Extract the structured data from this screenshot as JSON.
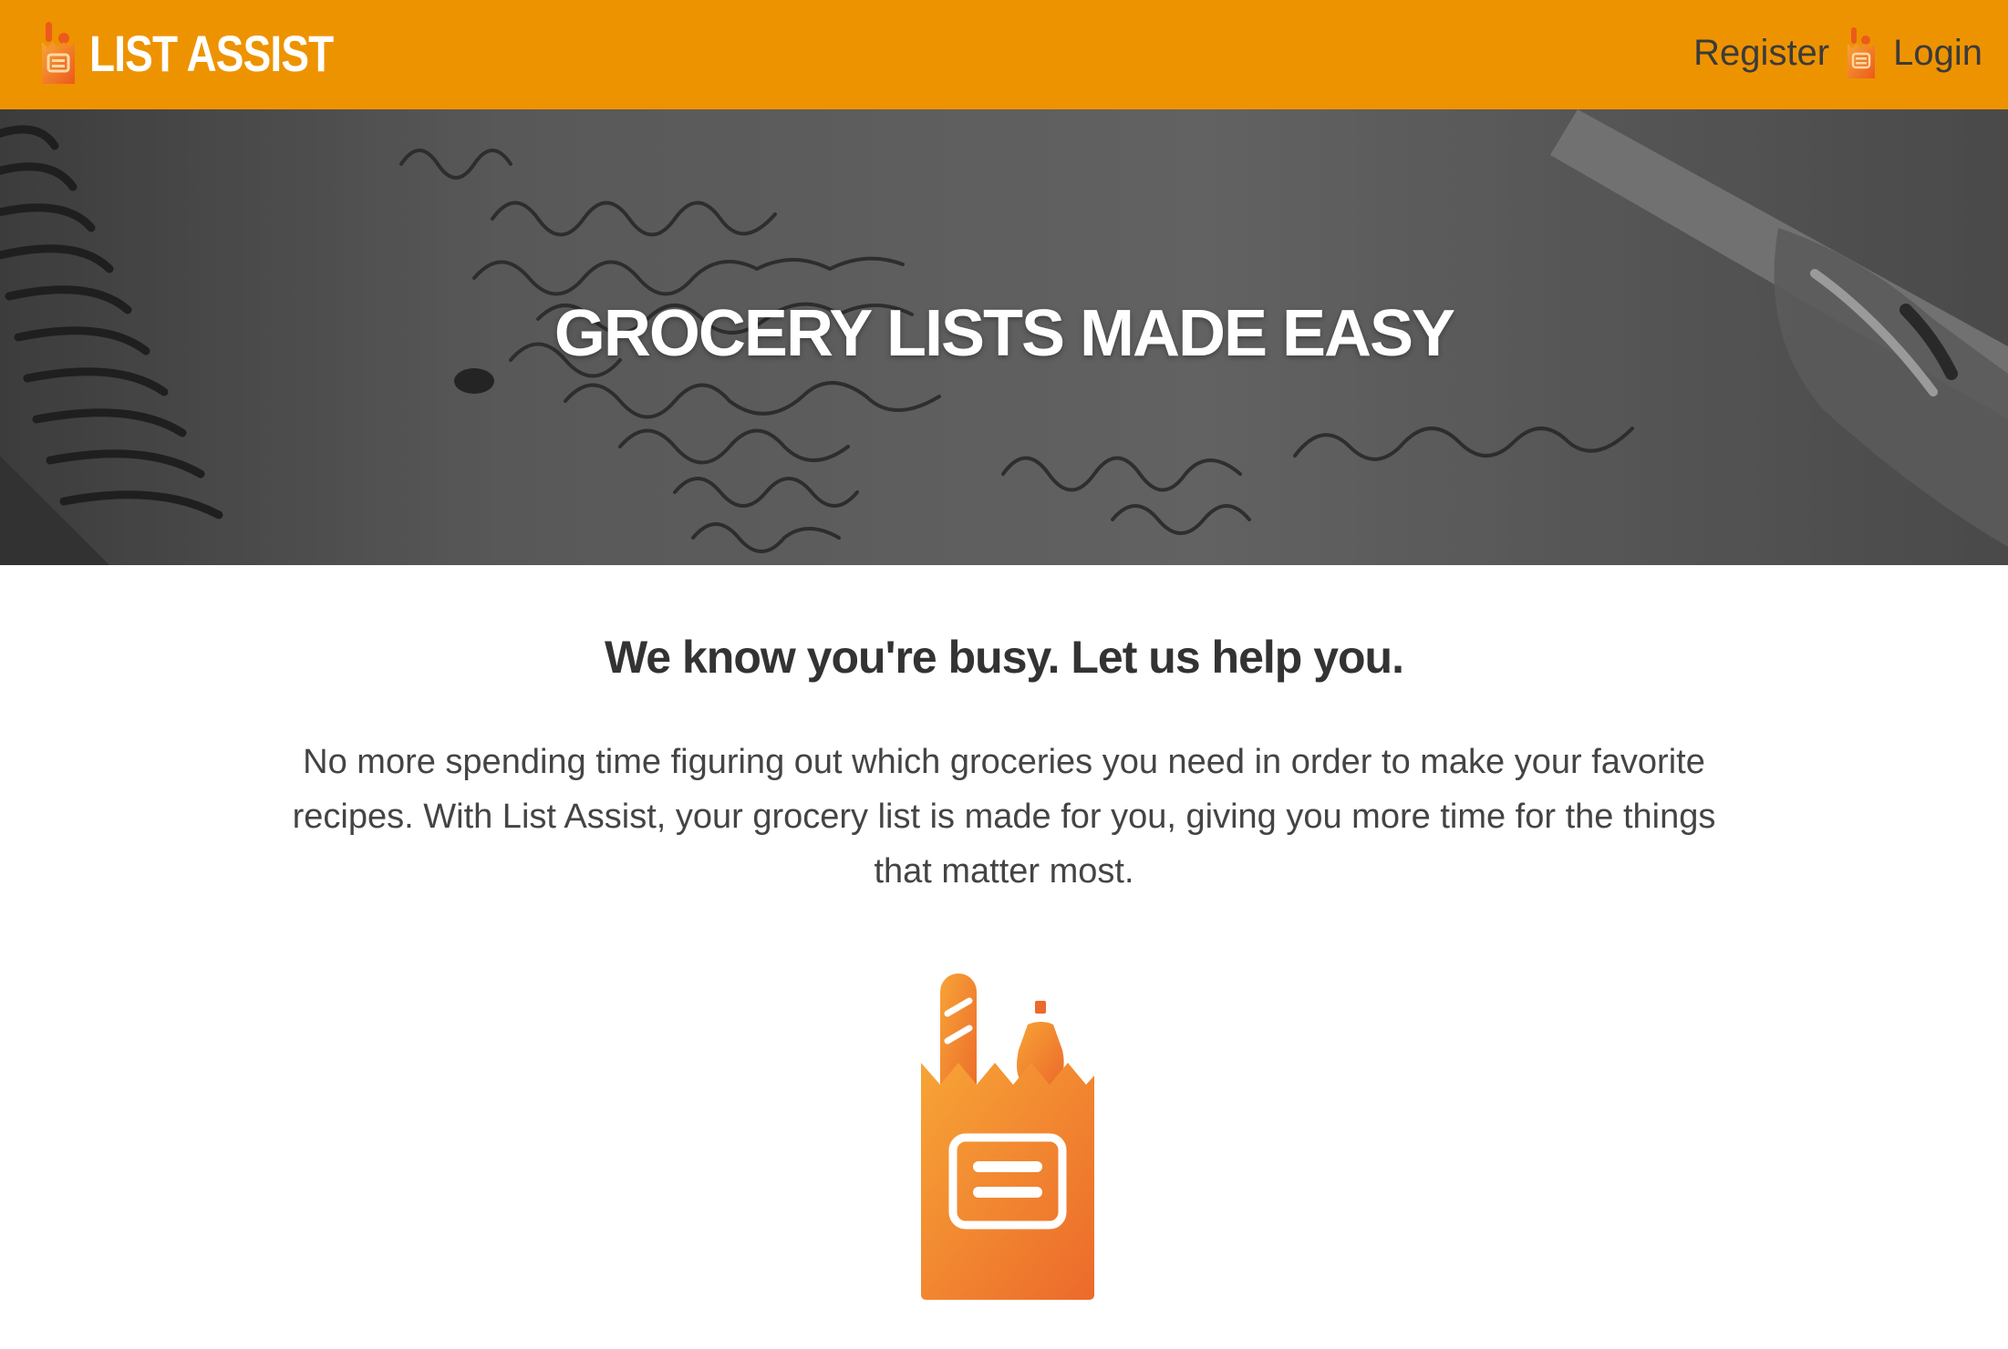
{
  "navbar": {
    "brand": "LIST ASSIST",
    "links": {
      "register": "Register",
      "login": "Login"
    },
    "background_color": "#ee9300",
    "icons": [
      "grocery-bag-logo-icon",
      "grocery-bag-small-icon"
    ]
  },
  "hero": {
    "title": "GROCERY LISTS MADE EASY",
    "background_description_icon": "handwritten-notebook-photo"
  },
  "content": {
    "subheading": "We know you're busy. Let us help you.",
    "description": "No more spending time figuring out which groceries you need in order to make your favorite recipes. With List Assist, your grocery list is made for you, giving you more time for the things that matter most.",
    "illustration_icon": "grocery-bag-icon"
  },
  "colors": {
    "accent_orange": "#ee9300",
    "bag_gradient_start": "#f7a436",
    "bag_gradient_end": "#ec6a2b",
    "text_dark": "#333333"
  }
}
